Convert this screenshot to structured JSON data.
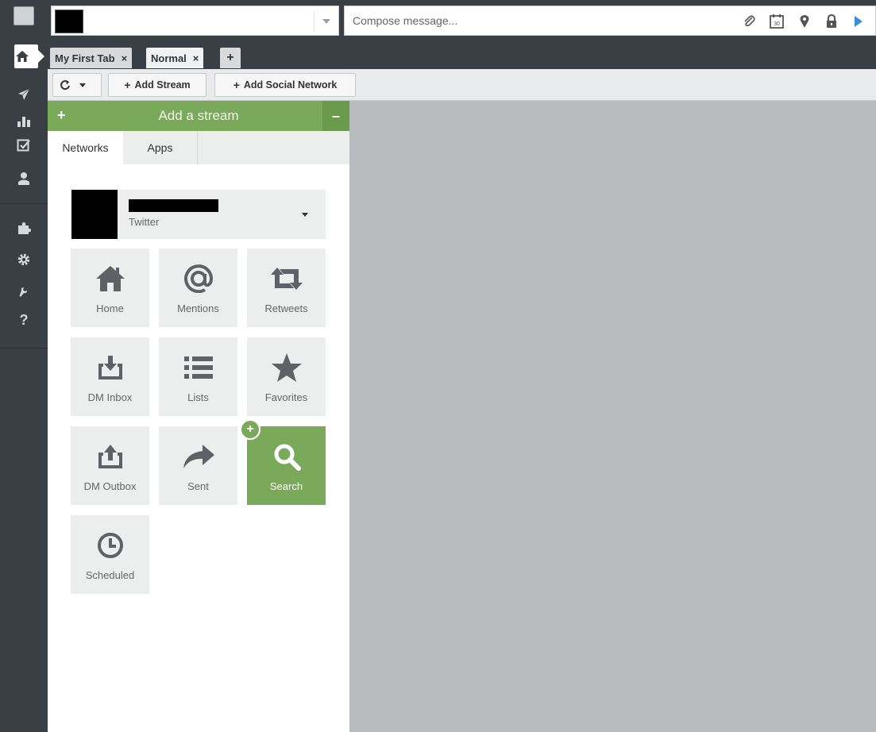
{
  "compose": {
    "placeholder": "Compose message..."
  },
  "tabs": [
    {
      "label": "My First Tab",
      "close": "×"
    },
    {
      "label": "Normal",
      "close": "×"
    }
  ],
  "tab_add": "+",
  "toolbar": {
    "add_stream_label": "Add Stream",
    "add_social_network_label": "Add Social Network",
    "plus": "+"
  },
  "panel": {
    "title": "Add a stream",
    "add_symbol": "+",
    "collapse_symbol": "–",
    "tabs": [
      "Networks",
      "Apps"
    ],
    "account": {
      "network": "Twitter"
    },
    "streams": [
      {
        "label": "Home",
        "icon": "home-icon"
      },
      {
        "label": "Mentions",
        "icon": "at-icon"
      },
      {
        "label": "Retweets",
        "icon": "retweet-icon"
      },
      {
        "label": "DM Inbox",
        "icon": "inbox-icon"
      },
      {
        "label": "Lists",
        "icon": "list-icon"
      },
      {
        "label": "Favorites",
        "icon": "star-icon"
      },
      {
        "label": "DM Outbox",
        "icon": "outbox-icon"
      },
      {
        "label": "Sent",
        "icon": "share-arrow-icon"
      },
      {
        "label": "Search",
        "icon": "search-icon",
        "selected": true
      },
      {
        "label": "Scheduled",
        "icon": "clock-icon"
      }
    ],
    "badge_symbol": "+"
  },
  "calendar_day": "30",
  "help_symbol": "?",
  "colors": {
    "sidebar": "#3a3f45",
    "accent_green": "#7ba95a",
    "workspace": "#b9bcbf",
    "send_blue": "#3b8fd6"
  }
}
